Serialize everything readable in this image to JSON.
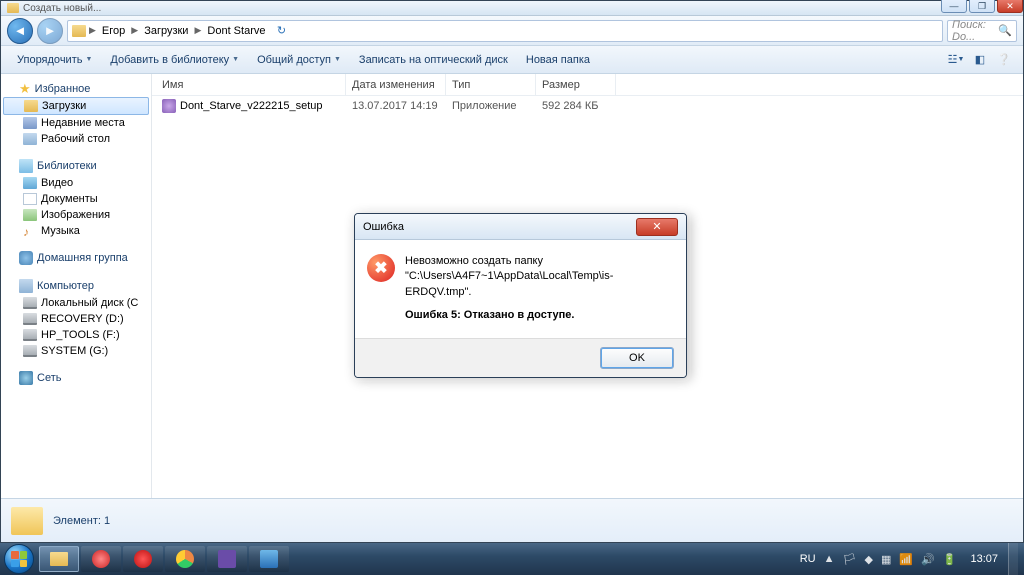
{
  "window": {
    "title_hint": "Создать новый..."
  },
  "breadcrumb": {
    "items": [
      "Егор",
      "Загрузки",
      "Dont Starve"
    ]
  },
  "search": {
    "placeholder": "Поиск: Do..."
  },
  "toolbar": {
    "organize": "Упорядочить",
    "include": "Добавить в библиотеку",
    "share": "Общий доступ",
    "burn": "Записать на оптический диск",
    "newfolder": "Новая папка"
  },
  "sidebar": {
    "favorites": {
      "label": "Избранное",
      "items": [
        "Загрузки",
        "Недавние места",
        "Рабочий стол"
      ]
    },
    "libraries": {
      "label": "Библиотеки",
      "items": [
        "Видео",
        "Документы",
        "Изображения",
        "Музыка"
      ]
    },
    "homegroup": {
      "label": "Домашняя группа"
    },
    "computer": {
      "label": "Компьютер",
      "items": [
        "Локальный диск (C",
        "RECOVERY (D:)",
        "HP_TOOLS (F:)",
        "SYSTEM (G:)"
      ]
    },
    "network": {
      "label": "Сеть"
    }
  },
  "columns": {
    "name": "Имя",
    "date": "Дата изменения",
    "type": "Тип",
    "size": "Размер"
  },
  "files": [
    {
      "name": "Dont_Starve_v222215_setup",
      "date": "13.07.2017 14:19",
      "type": "Приложение",
      "size": "592 284 КБ"
    }
  ],
  "details": {
    "label": "Элемент: 1"
  },
  "dialog": {
    "title": "Ошибка",
    "line1": "Невозможно создать папку",
    "line2": "\"C:\\Users\\A4F7~1\\AppData\\Local\\Temp\\is-ERDQV.tmp\".",
    "line3": "Ошибка 5: Отказано в доступе.",
    "ok": "OK"
  },
  "tray": {
    "lang": "RU",
    "time": "13:07"
  }
}
